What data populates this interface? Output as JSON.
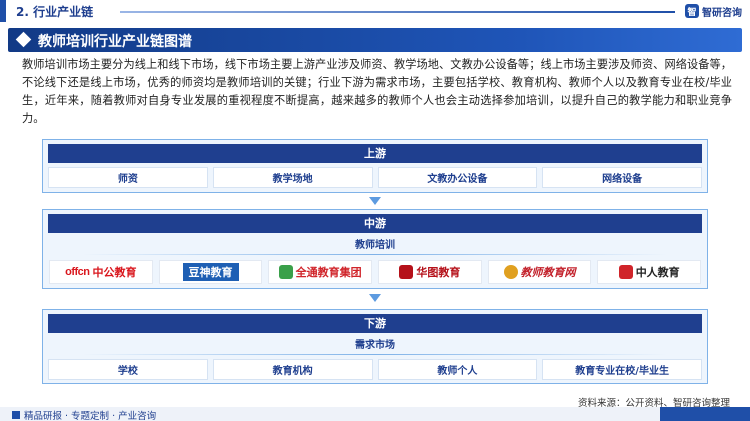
{
  "section": {
    "title": "2. 行业产业链"
  },
  "brand": {
    "logo_mark": "智",
    "name": "智研咨询"
  },
  "heading": "教师培训行业产业链图谱",
  "intro": "教师培训市场主要分为线上和线下市场，线下市场主要上游产业涉及师资、教学场地、文教办公设备等；线上市场主要涉及师资、网络设备等，不论线下还是线上市场，优秀的师资均是教师培训的关键；行业下游为需求市场，主要包括学校、教育机构、教师个人以及教育专业在校/毕业生，近年来，随着教师对自身专业发展的重视程度不断提高，越来越多的教师个人也会主动选择参加培训，以提升自己的教学能力和职业竞争力。",
  "upstream": {
    "title": "上游",
    "items": [
      "师资",
      "教学场地",
      "文教办公设备",
      "网络设备"
    ]
  },
  "midstream": {
    "title": "中游",
    "label": "教师培训",
    "logos": [
      {
        "icon": "offcn-logo-icon",
        "text_a": "offcn",
        "text_b": "中公教育"
      },
      {
        "icon": "doushen-logo-icon",
        "text": "豆神教育"
      },
      {
        "icon": "quantong-logo-icon",
        "text": "全通教育集团"
      },
      {
        "icon": "huatu-logo-icon",
        "text": "华图教育"
      },
      {
        "icon": "jiaoshi-logo-icon",
        "text": "教师教育网"
      },
      {
        "icon": "zhongren-logo-icon",
        "text": "中人教育"
      }
    ]
  },
  "downstream": {
    "title": "下游",
    "label": "需求市场",
    "items": [
      "学校",
      "教育机构",
      "教师个人",
      "教育专业在校/毕业生"
    ]
  },
  "footer": {
    "source": "资料来源：公开资料、智研咨询整理",
    "slogan": "精品研报 · 专题定制 · 产业咨询"
  },
  "colors": {
    "primary": "#1f3f8f",
    "accent": "#1f4fa8",
    "panel_border": "#7fb2e8"
  }
}
